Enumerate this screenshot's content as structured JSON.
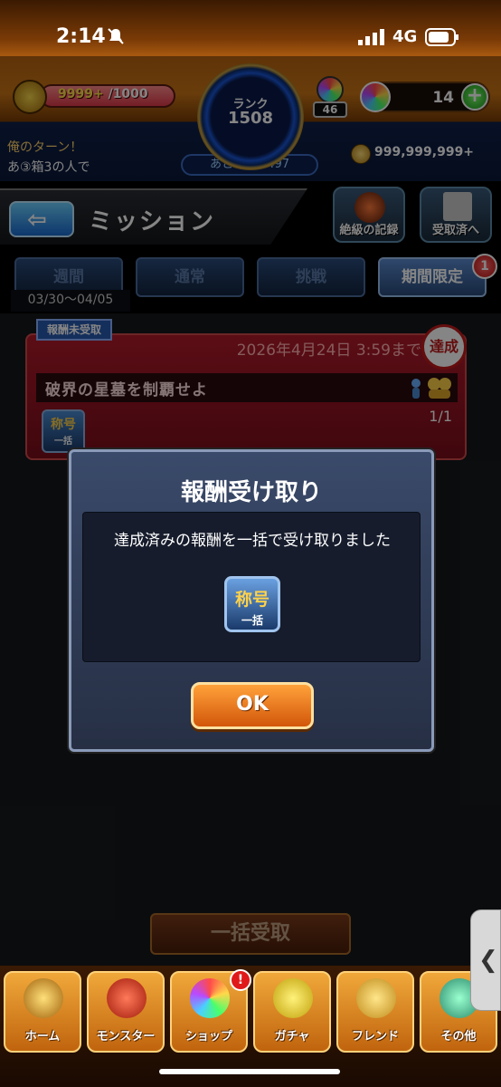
{
  "status": {
    "time": "2:14",
    "network": "4G"
  },
  "hud": {
    "stamina_value": "9999+",
    "stamina_max": "/1000",
    "rank_label": "ランク",
    "rank_value": "1508",
    "rank_next": "あと 1031497",
    "orb_stack_count": "46",
    "orb_count": "14",
    "turn_title": "俺のターン！",
    "turn_sub": "あ③箱3の人で",
    "gold": "999,999,999+"
  },
  "header": {
    "title": "ミッション",
    "back_icon": "back-arrow-icon",
    "record_label": "絶級の記録",
    "received_label": "受取済へ"
  },
  "tabs": [
    {
      "label": "週間"
    },
    {
      "label": "通常"
    },
    {
      "label": "挑戦"
    },
    {
      "label": "期間限定"
    }
  ],
  "tab_badge": "1",
  "date_range": "03/30〜04/05",
  "mission": {
    "tag": "報酬未受取",
    "deadline": "2026年4月24日 3:59まで",
    "stamp": "達成",
    "name": "破界の星墓を制覇せよ",
    "progress": "1/1",
    "reward_title": "称号",
    "reward_sub": "一括"
  },
  "modal": {
    "title": "報酬受け取り",
    "message": "達成済みの報酬を一括で受け取りました",
    "item_title": "称号",
    "item_sub": "一括",
    "ok_label": "OK"
  },
  "bulk_label": "一括受取",
  "nav": [
    {
      "label": "ホーム",
      "icon": "home-icon"
    },
    {
      "label": "モンスター",
      "icon": "monster-icon"
    },
    {
      "label": "ショップ",
      "icon": "shop-icon"
    },
    {
      "label": "ガチャ",
      "icon": "gacha-icon"
    },
    {
      "label": "フレンド",
      "icon": "friend-icon"
    },
    {
      "label": "その他",
      "icon": "other-icon"
    }
  ],
  "nav_alert": "!",
  "colors": {
    "accent": "#d2560a",
    "stamina": "#e03a4a",
    "tab_active": "#5a8ad0"
  }
}
